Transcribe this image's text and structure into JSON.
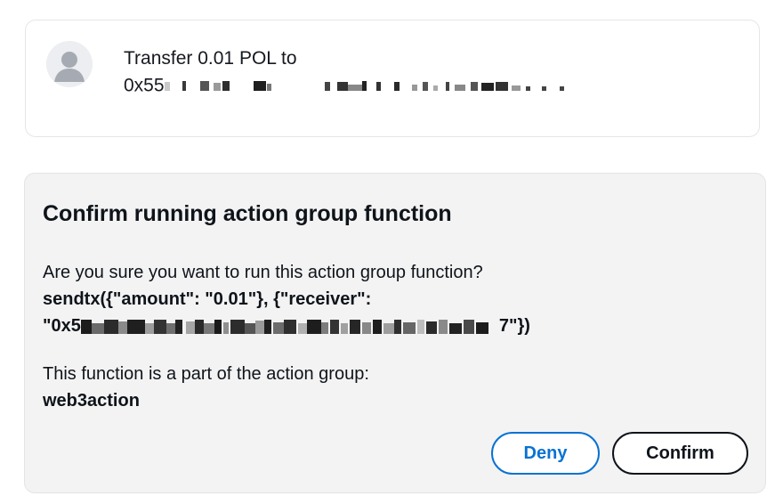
{
  "message": {
    "line1": "Transfer 0.01 POL to",
    "address_prefix": "0x55",
    "address_redacted": true
  },
  "confirm_dialog": {
    "title": "Confirm running action group function",
    "question": "Are you sure you want to run this action group function?",
    "function_call_line1": "sendtx({\"amount\": \"0.01\"}, {\"receiver\":",
    "function_call_line2_prefix": "\"0x5",
    "function_call_line2_suffix": "7\"})",
    "group_label": "This function is a part of the action group:",
    "group_name": "web3action",
    "deny_label": "Deny",
    "confirm_label": "Confirm"
  },
  "colors": {
    "deny_accent": "#0972d3",
    "confirm_accent": "#0f141a",
    "dialog_background": "#f3f3f3"
  },
  "icons": {
    "avatar": "user-avatar-icon"
  }
}
